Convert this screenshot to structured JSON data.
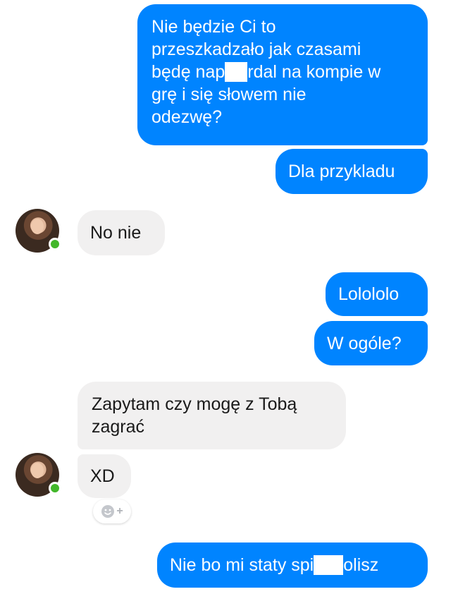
{
  "messages": {
    "m1": {
      "lines": [
        "Nie będzie Ci to",
        "przeszkadzało jak czasami",
        "będę nap",
        "rdal na kompie w",
        "grę i się słowem nie",
        "odezwę?"
      ]
    },
    "m2": "Dla przykladu",
    "m3": "No nie",
    "m4": "Lolololo",
    "m5": "W ogóle?",
    "m6": {
      "lines": [
        "Zapytam czy mogę z Tobą",
        "zagrać"
      ]
    },
    "m7": "XD",
    "m8": {
      "before": "Nie bo mi staty spi",
      "after": "olisz"
    }
  },
  "colors": {
    "outgoing_bubble": "#0084ff",
    "incoming_bubble": "#f1f0f0",
    "online_dot": "#42b72a"
  },
  "icons": {
    "react": "smiley-add-icon",
    "online": "online-status-dot"
  }
}
